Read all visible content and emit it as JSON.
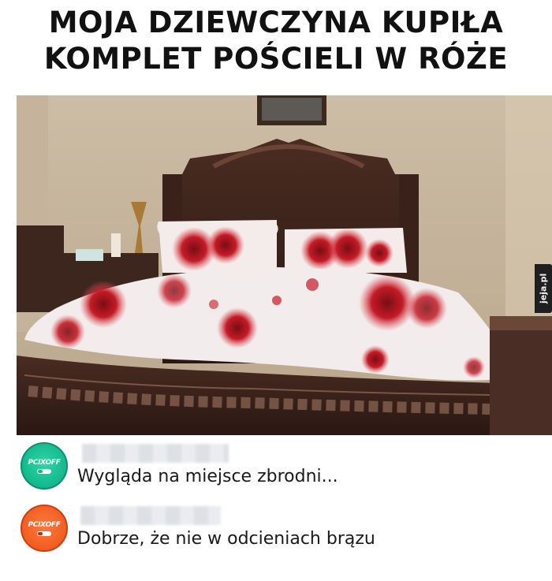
{
  "title": {
    "line1": "MOJA DZIEWCZYNA KUPIŁA",
    "line2": "KOMPLET POŚCIELI W RÓŻE"
  },
  "watermark": {
    "text": "jeja.pl"
  },
  "comments": [
    {
      "avatar_label": "PCIXOFF",
      "avatar_color": "#13b88c",
      "text": "Wygląda na miejsce zbrodni..."
    },
    {
      "avatar_label": "PCIXOFF",
      "avatar_color": "#f25d20",
      "text": "Dobrze, że nie w odcieniach brązu"
    }
  ]
}
